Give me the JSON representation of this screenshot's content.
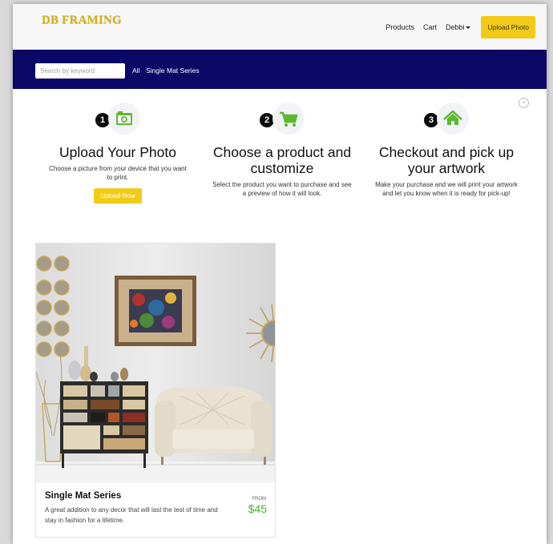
{
  "header": {
    "brand": "DB FRAMING",
    "nav": {
      "products": "Products",
      "cart": "Cart",
      "user": "Debbi"
    },
    "upload_button": "Upload Photo"
  },
  "search": {
    "placeholder": "Search by keyword",
    "links": [
      "All",
      "Single Mat Series"
    ]
  },
  "steps": [
    {
      "number": "1",
      "icon": "camera-icon",
      "title": "Upload Your Photo",
      "description": "Choose a picture from your device that you want to print.",
      "button": "Upload Now"
    },
    {
      "number": "2",
      "icon": "cart-icon",
      "title": "Choose a product and customize",
      "description": "Select the product you want to purchase and see a preview of how it will look."
    },
    {
      "number": "3",
      "icon": "home-icon",
      "title": "Checkout and pick up your artwork",
      "description": "Make your purchase and we will print your artwork and let you know when it is ready for pick-up!"
    }
  ],
  "product": {
    "title": "Single Mat Series",
    "description": "A great addition to any decor that will last the test of time and stay in fashion for a lifetime.",
    "price_label": "FROM",
    "price": "$45"
  },
  "colors": {
    "brand_gold": "#d7b217",
    "accent_yellow": "#f1cb17",
    "navy": "#0a0767",
    "icon_green": "#5cb82e",
    "price_green": "#4bb03a"
  }
}
